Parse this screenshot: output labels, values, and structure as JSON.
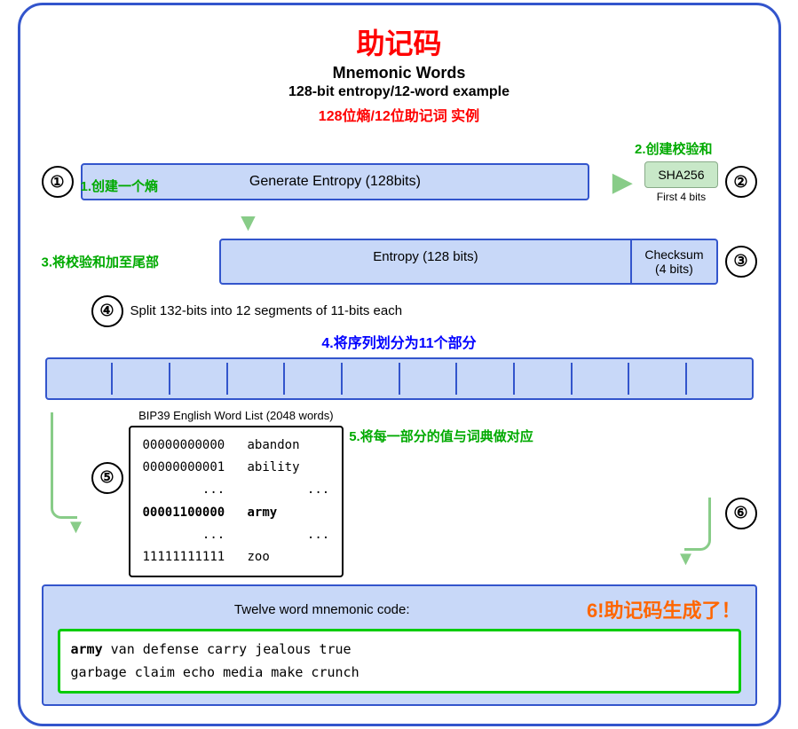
{
  "title": {
    "chinese": "助记码",
    "english_title": "Mnemonic Words",
    "english_subtitle": "128-bit entropy/12-word example",
    "chinese_subtitle": "128位熵/12位助记词 实例"
  },
  "labels": {
    "step1": "1.创建一个熵",
    "step2": "2.创建校验和",
    "step3": "3.将校验和加至尾部",
    "step4_circle": "4",
    "step4_en": "Split 132-bits into 12 segments of 11-bits each",
    "step4_cn": "4.将序列划分为11个部分",
    "step5_cn": "5.将每一部分的值与词典做对应",
    "step6": "6!助记码生成了！",
    "sha256": "SHA256",
    "first4bits": "First 4 bits",
    "entropy_128": "Generate Entropy (128bits)",
    "entropy_128_row2": "Entropy (128 bits)",
    "checksum": "Checksum",
    "checksum_bits": "(4 bits)",
    "bip39_label": "BIP39 English Word List (2048 words)",
    "twelve_word_label": "Twelve word mnemonic code:",
    "mnemonic_line1": "army van defense carry jealous true",
    "mnemonic_line2": "garbage claim echo media make crunch",
    "mnemonic_bold": "army"
  },
  "wordlist": {
    "rows": [
      {
        "bits": "00000000000",
        "word": "abandon",
        "bold": false
      },
      {
        "bits": "00000000001",
        "word": "ability",
        "bold": false
      },
      {
        "bits": "...",
        "word": "...",
        "bold": false
      },
      {
        "bits": "00001100000",
        "word": "army",
        "bold": true
      },
      {
        "bits": "...",
        "word": "...",
        "bold": false
      },
      {
        "bits": "11111111111",
        "word": "zoo",
        "bold": false
      }
    ]
  },
  "steps": {
    "circle1": "①",
    "circle2": "②",
    "circle3": "③",
    "circle4": "④",
    "circle5": "⑤",
    "circle6": "⑥"
  },
  "colors": {
    "red": "#ff0000",
    "green": "#00aa00",
    "blue": "#3355cc",
    "light_blue_bg": "#c8d8f8",
    "light_green_bg": "#c8e8c8",
    "green_arrow": "#88cc88",
    "orange": "#ff6600",
    "bright_green_border": "#00cc00"
  }
}
